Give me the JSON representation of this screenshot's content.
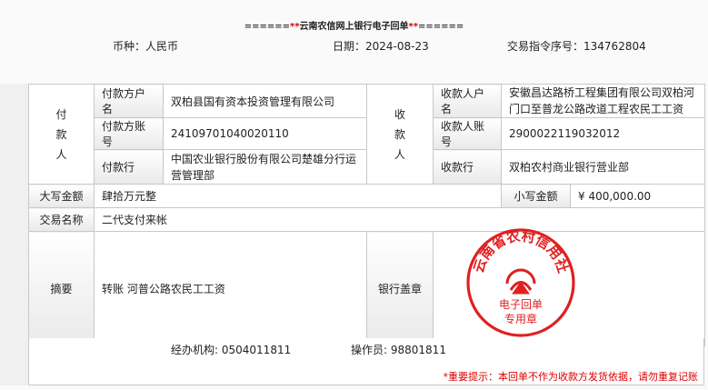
{
  "title": {
    "pre": "======",
    "star1": "**",
    "text": "云南农信网上银行电子回单",
    "star2": "**",
    "post": "======"
  },
  "header": {
    "currency_label": "币种：",
    "currency": "人民币",
    "date_label": "日期：",
    "date": "2024-08-23",
    "txn_label": "交易指令序号：",
    "txn": "134762804"
  },
  "payer": {
    "section": "付\n款\n人",
    "name_label": "付款方户名",
    "name": "双柏县国有资本投资管理有限公司",
    "account_label": "付款方账号",
    "account": "24109701040020110",
    "bank_label": "付款行",
    "bank": "中国农业银行股份有限公司楚雄分行运营管理部"
  },
  "payee": {
    "section": "收\n款\n人",
    "name_label": "收款人户名",
    "name": "安徽昌达路桥工程集团有限公司双柏河门口至普龙公路改道工程农民工工资",
    "account_label": "收款人账号",
    "account": "2900022119032012",
    "bank_label": "收款行",
    "bank": "双柏农村商业银行营业部"
  },
  "amount": {
    "caps_label": "大写金额",
    "caps": "肆拾万元整",
    "small_label": "小写金额",
    "small": "¥ 400,000.00"
  },
  "txn_name": {
    "label": "交易名称",
    "value": "二代支付来帐"
  },
  "memo": {
    "label": "摘要",
    "value": "转账 河普公路农民工工资"
  },
  "seal": {
    "label": "银行盖章",
    "stamp_top": "云南省农村信用社",
    "stamp_mid": "电子回单",
    "stamp_bottom": "专用章",
    "color": "#e02020"
  },
  "footer": {
    "agency_label": "经办机构:",
    "agency": "0504011811",
    "operator_label": "操作员:",
    "operator": "98801811",
    "tip": "*重要提示：本回单不作为收款方发货依据，请勿重复记账"
  }
}
